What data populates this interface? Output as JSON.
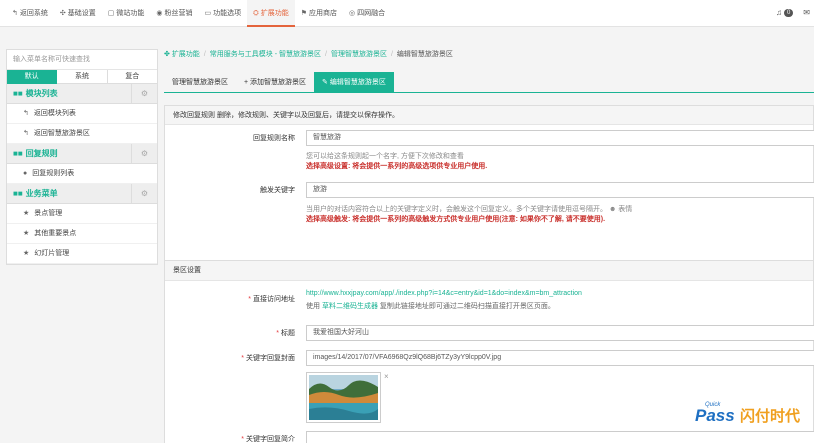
{
  "topnav": {
    "items": [
      {
        "icon": "↰",
        "label": "返回系统"
      },
      {
        "icon": "✣",
        "label": "基础设置"
      },
      {
        "icon": "▢",
        "label": "微站功能"
      },
      {
        "icon": "◉",
        "label": "粉丝营销"
      },
      {
        "icon": "▭",
        "label": "功能选项"
      },
      {
        "icon": "⛭",
        "label": "扩展功能"
      },
      {
        "icon": "⚑",
        "label": "应用商店"
      },
      {
        "icon": "◎",
        "label": "四网融合"
      }
    ],
    "notification_count": "0"
  },
  "sidebar": {
    "search_placeholder": "输入菜单名称可快速查找",
    "tabs": [
      "默认",
      "系统",
      "复合"
    ],
    "sections": [
      {
        "title": "模块列表",
        "items": [
          "返回模块列表",
          "返回智慧旅游景区"
        ]
      },
      {
        "title": "回复规则",
        "items": [
          "回复规则列表"
        ]
      },
      {
        "title": "业务菜单",
        "items": [
          "景点管理",
          "其他重要景点",
          "幻灯片管理"
        ]
      }
    ]
  },
  "breadcrumb": {
    "items": [
      "扩展功能",
      "常用服务与工具模块 - 智慧旅游景区",
      "管理智慧旅游景区"
    ],
    "current": "编辑智慧旅游景区"
  },
  "page_tabs": [
    "管理智慧旅游景区",
    "+ 添加智慧旅游景区",
    "编辑智慧旅游景区"
  ],
  "reply_panel": {
    "header": "修改回复规则 删除，修改规则、关键字以及回复后，请提交以保存操作。",
    "rule_name_label": "回复规则名称",
    "rule_name_value": "智慧旅游",
    "rule_name_help": "您可以给这条规则起一个名字, 方便下次修改和查看",
    "rule_name_warn": "选择高级设置: 将会提供一系列的高级选项供专业用户使用.",
    "keyword_label": "触发关键字",
    "keyword_value": "旅游",
    "keyword_help": "当用户的对话内容符合以上的关键字定义时，会触发这个回复定义。多个关键字请使用逗号隔开。",
    "keyword_help_emoji": "表情",
    "keyword_warn": "选择高级触发: 将会提供一系列的高级触发方式供专业用户使用(注意: 如果你不了解, 请不要使用)."
  },
  "scenic_panel": {
    "header": "景区设置",
    "url_label": "直接访问地址",
    "url_value": "http://www.hxxjpay.com/app/./index.php?i=14&c=entry&id=1&do=index&m=bm_attraction",
    "url_help_prefix": "使用",
    "url_help_link": "草料二维码生成器",
    "url_help_suffix": "复制此链接地址即可通过二维码扫描直接打开景区页面。",
    "title_label": "标题",
    "title_value": "我爱祖国大好河山",
    "cover_label": "关键字回复封面",
    "cover_value": "images/14/2017/07/VFA6968Qz9lQ68Bj6TZy3yY9lcpp0V.jpg",
    "intro_label": "关键字回复简介"
  },
  "watermark": {
    "quick": "Quick",
    "pass": "Pass",
    "brand": "闪付时代"
  },
  "colors": {
    "accent": "#1ab394",
    "active_nav": "#e4643c",
    "warning": "#c9302c"
  }
}
